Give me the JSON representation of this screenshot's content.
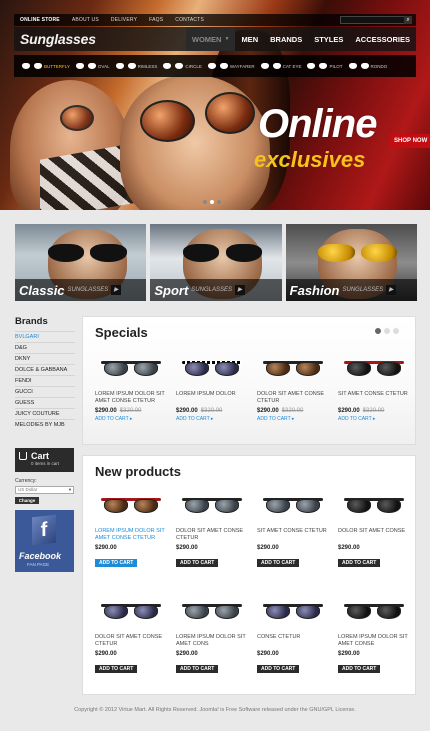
{
  "colors": {
    "accent": "#1e8bd6",
    "promo_yellow": "#f5c31b",
    "shop_red": "#c40d12",
    "dark_bar": "#2b2b2b"
  },
  "topbar": {
    "links": [
      "Online store",
      "About us",
      "Delivery",
      "FAQs",
      "Contacts"
    ],
    "search_placeholder": "",
    "search_icon": "search-icon"
  },
  "header": {
    "logo": "Sunglasses",
    "nav": [
      "Women",
      "Men",
      "Brands",
      "Styles",
      "Accessories"
    ]
  },
  "styles_menu": [
    "Butterfly",
    "Oval",
    "Rimless",
    "Circle",
    "Wayfarer",
    "Cat Eye",
    "Pilot",
    "Rondo"
  ],
  "hero": {
    "title": "Online",
    "subtitle": "exclusives",
    "cta": "Shop now",
    "slide_count": 3,
    "active_slide": 1
  },
  "categories": [
    {
      "title": "Classic",
      "sub": "Sunglasses"
    },
    {
      "title": "Sport",
      "sub": "Sunglasses"
    },
    {
      "title": "Fashion",
      "sub": "Sunglasses"
    }
  ],
  "sidebar": {
    "brands_title": "Brands",
    "brands": [
      "Bvlgari",
      "D&G",
      "DKNY",
      "Dolce & Gabbana",
      "Fendi",
      "Gucci",
      "Guess",
      "Juicy Couture",
      "Melodies by MJB"
    ],
    "cart_title": "Cart",
    "cart_items": "0 items in cart",
    "currency_label": "Currency:",
    "currency_value": "US Dollar",
    "change_button": "Change",
    "facebook_title": "Facebook",
    "facebook_sub": "Fan Page"
  },
  "specials": {
    "title": "Specials",
    "dots": 3,
    "active_dot": 1,
    "items": [
      {
        "name": "Lorem ipsum dolor sit amet conse ctetur",
        "price": "$290.00",
        "old": "$320.00",
        "link": "Add to cart"
      },
      {
        "name": "Lorem ipsum dolor",
        "price": "$290.00",
        "old": "$320.00",
        "link": "Add to cart"
      },
      {
        "name": "Dolor sit amet conse ctetur",
        "price": "$290.00",
        "old": "$320.00",
        "link": "Add to cart"
      },
      {
        "name": "Sit amet conse ctetur",
        "price": "$290.00",
        "old": "$320.00",
        "link": "Add to cart"
      }
    ]
  },
  "new_products": {
    "title": "New products",
    "button": "Add to cart",
    "items": [
      {
        "name": "Lorem ipsum dolor sit amet conse ctetur",
        "price": "$290.00"
      },
      {
        "name": "Dolor sit amet conse ctetur",
        "price": "$290.00"
      },
      {
        "name": "Sit amet conse ctetur",
        "price": "$290.00"
      },
      {
        "name": "Dolor sit amet conse",
        "price": "$290.00"
      },
      {
        "name": "Dolor sit amet conse ctetur",
        "price": "$290.00"
      },
      {
        "name": "Lorem ipsum dolor sit amet cons",
        "price": "$290.00"
      },
      {
        "name": "Conse ctetur",
        "price": "$290.00"
      },
      {
        "name": "Lorem ipsum dolor sit amet conse",
        "price": "$290.00"
      }
    ]
  },
  "footer": {
    "text": "Copyright © 2012 Virtue Mart. All Rights Reserved. Joomla! is Free Software released under the GNU/GPL License."
  }
}
